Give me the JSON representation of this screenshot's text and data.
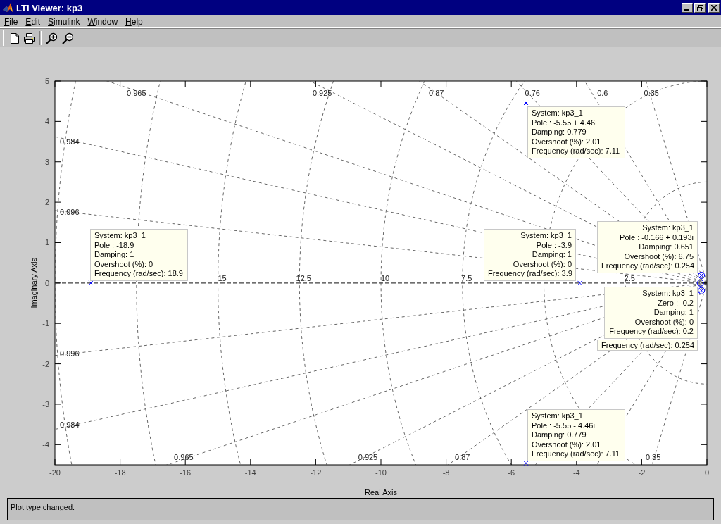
{
  "window": {
    "title": "LTI Viewer: kp3"
  },
  "menu": [
    {
      "label": "File"
    },
    {
      "label": "Edit"
    },
    {
      "label": "Simulink"
    },
    {
      "label": "Window"
    },
    {
      "label": "Help"
    }
  ],
  "toolbar": [
    {
      "kind": "new"
    },
    {
      "kind": "print"
    },
    {
      "kind": "zoom-in"
    },
    {
      "kind": "zoom-out"
    }
  ],
  "plot": {
    "chart_data": {
      "type": "scatter",
      "xlabel": "Real Axis",
      "ylabel": "Imaginary Axis",
      "xlim": [
        -20,
        0
      ],
      "ylim": [
        -4.5,
        5
      ],
      "xticks": [
        -20,
        -18,
        -16,
        -14,
        -12,
        -10,
        -8,
        -6,
        -4,
        -2,
        0
      ],
      "yticks": [
        -4,
        -3,
        -2,
        -1,
        0,
        1,
        2,
        3,
        4,
        5
      ],
      "series": [
        {
          "color": "#0000ff",
          "x": [
            -5.55,
            -18.9,
            -3.9,
            -0.17,
            -0.17,
            -5.55
          ],
          "values": [
            4.46,
            0,
            0,
            0.19,
            -0.19,
            -4.46
          ]
        },
        {
          "color": "#0000ff",
          "x": [
            -0.2,
            -0.17,
            -0.17
          ],
          "values": [
            0,
            0.19,
            -0.19
          ]
        }
      ]
    },
    "damping_labels": [
      "0.965",
      "0.925",
      "0.87",
      "0.76",
      "0.6",
      "0.35",
      "0.984",
      "0.996",
      "0.996",
      "0.984",
      "0.965",
      "0.925",
      "0.87",
      "0.35"
    ],
    "frequency_labels": [
      "15",
      "12.5",
      "10",
      "7.5",
      "2.5"
    ],
    "datatips": [
      {
        "lines": [
          "System: kp3_1",
          "Pole : -5.55 + 4.46i",
          "Damping: 0.779",
          "Overshoot (%): 2.01",
          "Frequency (rad/sec): 7.11"
        ]
      },
      {
        "lines": [
          "System: kp3_1",
          "Pole : -0.166 + 0.193i",
          "Damping: 0.651",
          "Overshoot (%): 6.75",
          "Frequency (rad/sec): 0.254"
        ]
      },
      {
        "lines": [
          "System: kp3_1",
          "Pole : -18.9",
          "Damping: 1",
          "Overshoot (%): 0",
          "Frequency (rad/sec): 18.9"
        ]
      },
      {
        "lines": [
          "System: kp3_1",
          "Pole : -3.9",
          "Damping: 1",
          "Overshoot (%): 0",
          "Frequency (rad/sec): 3.9"
        ]
      },
      {
        "lines": [
          "System: kp3_1",
          "Zero : -0.2",
          "Damping: 1",
          "Overshoot (%): 0",
          "Frequency (rad/sec): 0.2"
        ]
      },
      {
        "lines": [
          "Frequency (rad/sec): 0.254"
        ]
      },
      {
        "lines": [
          "System: kp3_1",
          "Pole : -5.55 - 4.46i",
          "Damping: 0.779",
          "Overshoot (%): 2.01",
          "Frequency (rad/sec): 7.11"
        ]
      }
    ]
  },
  "status_bar": {
    "message": "Plot type changed."
  }
}
